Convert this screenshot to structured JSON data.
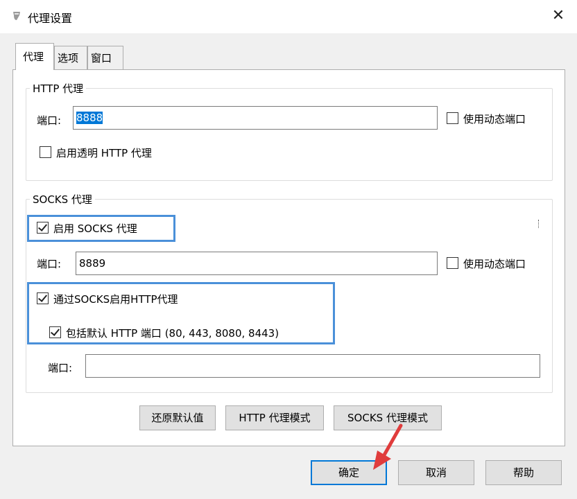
{
  "window": {
    "title": "代理设置",
    "close_glyph": "✕",
    "icon": "app-icon"
  },
  "tabs": [
    {
      "label": "代理",
      "active": true
    },
    {
      "label": "选项",
      "active": false
    },
    {
      "label": "窗口",
      "active": false
    }
  ],
  "http_proxy": {
    "group_label": "HTTP 代理",
    "port_label": "端口:",
    "port_value": "8888",
    "dynamic_port_label": "使用动态端口",
    "dynamic_port_checked": false,
    "transparent_label": "启用透明 HTTP 代理",
    "transparent_checked": false
  },
  "socks_proxy": {
    "group_label": "SOCKS 代理",
    "enable_label": "启用 SOCKS 代理",
    "enable_checked": true,
    "port_label": "端口:",
    "port_value": "8889",
    "dynamic_port_label": "使用动态端口",
    "dynamic_port_checked": false,
    "http_via_socks_label": "通过SOCKS启用HTTP代理",
    "http_via_socks_checked": true,
    "include_default_label": "包括默认 HTTP 端口 (80, 443, 8080, 8443)",
    "include_default_checked": true,
    "extra_port_label": "端口:",
    "extra_port_value": ""
  },
  "mode_buttons": {
    "restore": "还原默认值",
    "http_mode": "HTTP 代理模式",
    "socks_mode": "SOCKS 代理模式"
  },
  "dialog_buttons": {
    "ok": "确定",
    "cancel": "取消",
    "help": "帮助"
  },
  "colors": {
    "highlight": "#4a90d9",
    "arrow": "#e03c3c",
    "selection": "#0078d7"
  }
}
